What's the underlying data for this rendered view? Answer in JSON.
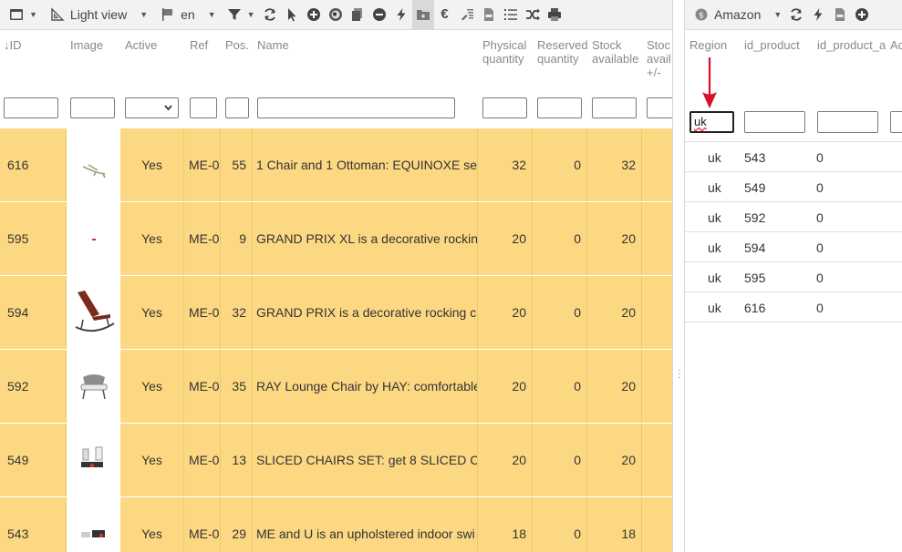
{
  "left_toolbar": {
    "view_label": "Light view",
    "lang_label": "en"
  },
  "right_toolbar": {
    "channel_label": "Amazon"
  },
  "left_grid": {
    "columns": {
      "id": "ID",
      "image": "Image",
      "active": "Active",
      "ref": "Ref",
      "pos": "Pos.",
      "name": "Name",
      "physical_qty_1": "Physical",
      "physical_qty_2": "quantity",
      "reserved_qty_1": "Reserved",
      "reserved_qty_2": "quantity",
      "stock_avail_1": "Stock",
      "stock_avail_2": "available",
      "stock_avail_pm_1": "Stoc",
      "stock_avail_pm_2": "avail",
      "stock_avail_pm_3": "+/-"
    },
    "rows": [
      {
        "id": "616",
        "active": "Yes",
        "ref": "ME-0",
        "pos": "55",
        "name": "1 Chair and 1 Ottoman: EQUINOXE se",
        "physical": "32",
        "reserved": "0",
        "stock": "32"
      },
      {
        "id": "595",
        "active": "Yes",
        "ref": "ME-0",
        "pos": "9",
        "name": "GRAND PRIX XL is a decorative rockin",
        "physical": "20",
        "reserved": "0",
        "stock": "20"
      },
      {
        "id": "594",
        "active": "Yes",
        "ref": "ME-0",
        "pos": "32",
        "name": "GRAND PRIX is a decorative rocking c",
        "physical": "20",
        "reserved": "0",
        "stock": "20"
      },
      {
        "id": "592",
        "active": "Yes",
        "ref": "ME-0",
        "pos": "35",
        "name": "RAY Lounge Chair by HAY: comfortable",
        "physical": "20",
        "reserved": "0",
        "stock": "20"
      },
      {
        "id": "549",
        "active": "Yes",
        "ref": "ME-0",
        "pos": "13",
        "name": "SLICED CHAIRS SET: get 8 SLICED C",
        "physical": "20",
        "reserved": "0",
        "stock": "20"
      },
      {
        "id": "543",
        "active": "Yes",
        "ref": "ME-0",
        "pos": "29",
        "name": "ME and U is an upholstered indoor swi",
        "physical": "18",
        "reserved": "0",
        "stock": "18"
      }
    ]
  },
  "right_grid": {
    "columns": {
      "region": "Region",
      "id_product": "id_product",
      "id_product_attr": "id_product_a",
      "extra": "Ac"
    },
    "region_filter_value": "uk",
    "rows": [
      {
        "region": "uk",
        "id_product": "543",
        "attr": "0"
      },
      {
        "region": "uk",
        "id_product": "549",
        "attr": "0"
      },
      {
        "region": "uk",
        "id_product": "592",
        "attr": "0"
      },
      {
        "region": "uk",
        "id_product": "594",
        "attr": "0"
      },
      {
        "region": "uk",
        "id_product": "595",
        "attr": "0"
      },
      {
        "region": "uk",
        "id_product": "616",
        "attr": "0"
      }
    ]
  },
  "annotation": {
    "arrow_color": "#d9102b"
  }
}
